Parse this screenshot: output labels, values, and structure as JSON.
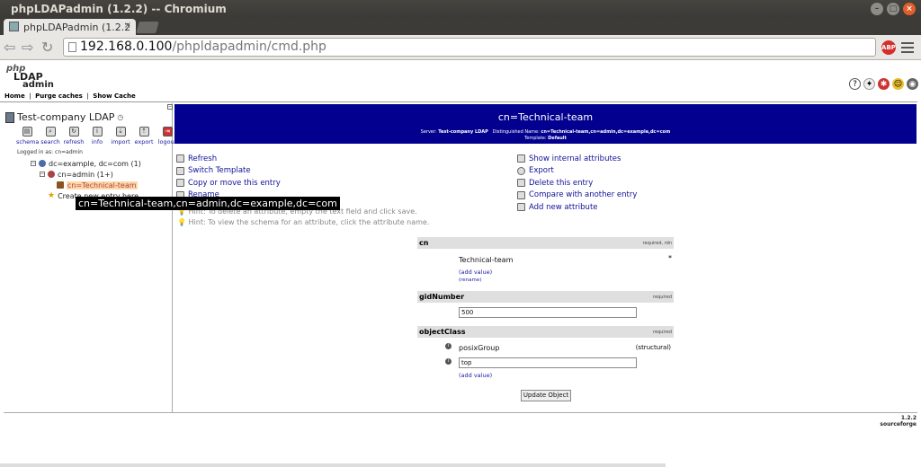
{
  "window": {
    "title": "phpLDAPadmin (1.2.2) -- Chromium"
  },
  "tab": {
    "label": "phpLDAPadmin (1.2.2",
    "close": "×"
  },
  "address": {
    "host": "192.168.0.100",
    "path": "/phpldapadmin/cmd.php"
  },
  "extension": {
    "abp": "ABP"
  },
  "logo": {
    "l1": "php",
    "l2": "LDAP",
    "l3": "admin"
  },
  "toplinks": {
    "home": "Home",
    "purge": "Purge caches",
    "show_cache": "Show Cache",
    "sep": "|"
  },
  "server": {
    "name": "Test-company LDAP",
    "actions": [
      {
        "label": "schema"
      },
      {
        "label": "search"
      },
      {
        "label": "refresh"
      },
      {
        "label": "info"
      },
      {
        "label": "import"
      },
      {
        "label": "export"
      },
      {
        "label": "logout"
      }
    ],
    "logged_in": "Logged in as: cn=admin"
  },
  "tree": {
    "root": "dc=example, dc=com (1)",
    "admin": "cn=admin (1+)",
    "selected": "cn=Technical-team",
    "create": "Create new entry here"
  },
  "tooltip": "cn=Technical-team,cn=admin,dc=example,dc=com",
  "header": {
    "dn": "cn=Technical-team",
    "server_label": "Server:",
    "server_value": "Test-company LDAP",
    "dn_label": "Distinguished Name:",
    "dn_value": "cn=Technical-team,cn=admin,dc=example,dc=com",
    "template_label": "Template:",
    "template_value": "Default"
  },
  "actions_left": [
    "Refresh",
    "Switch Template",
    "Copy or move this entry",
    "Rename"
  ],
  "actions_right": [
    "Show internal attributes",
    "Export",
    "Delete this entry",
    "Compare with another entry",
    "Add new attribute"
  ],
  "hints": [
    "Hint: To delete an attribute, empty the text field and click save.",
    "Hint: To view the schema for an attribute, click the attribute name."
  ],
  "attributes": {
    "cn": {
      "name": "cn",
      "note": "required, rdn",
      "value": "Technical-team",
      "add": "(add value)",
      "rename": "(rename)",
      "star": "*"
    },
    "gid": {
      "name": "gidNumber",
      "note": "required",
      "value": "500"
    },
    "oc": {
      "name": "objectClass",
      "note": "required",
      "v1": "posixGroup",
      "v1note": "(structural)",
      "v2": "top",
      "add": "(add value)"
    }
  },
  "update_button": "Update Object",
  "version": {
    "num": "1.2.2",
    "brand": "sourceforge"
  }
}
